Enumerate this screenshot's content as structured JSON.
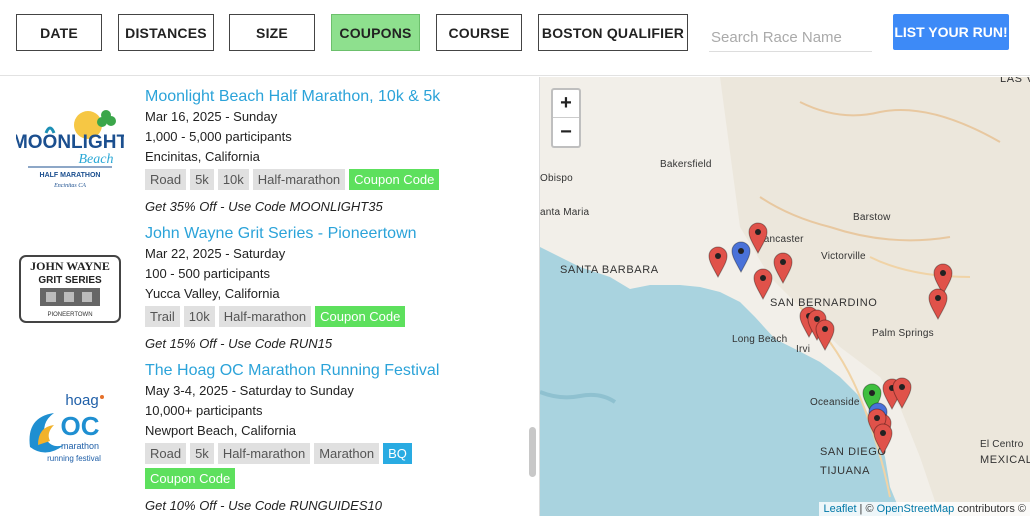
{
  "filters": [
    {
      "label": "DATE",
      "active": false
    },
    {
      "label": "DISTANCES",
      "active": false
    },
    {
      "label": "SIZE",
      "active": false
    },
    {
      "label": "COUPONS",
      "active": true
    },
    {
      "label": "COURSE",
      "active": false
    },
    {
      "label": "BOSTON QUALIFIER",
      "active": false
    }
  ],
  "search": {
    "placeholder": "Search Race Name"
  },
  "list_button": "LIST YOUR RUN!",
  "races": [
    {
      "title": "Moonlight Beach Half Marathon, 10k & 5k",
      "date": "Mar 16, 2025 - Sunday",
      "participants": "1,000 - 5,000 participants",
      "location": "Encinitas, California",
      "tags": [
        "Road",
        "5k",
        "10k",
        "Half-marathon"
      ],
      "coupon_tag": "Coupon Code",
      "coupon": "Get 35% Off - Use Code MOONLIGHT35",
      "logo": {
        "line1": "MOONLIGHT",
        "line2": "Beach",
        "line3": "HALF MARATHON",
        "line4": "Encinitas CA"
      }
    },
    {
      "title": "John Wayne Grit Series - Pioneertown",
      "date": "Mar 22, 2025 - Saturday",
      "participants": "100 - 500 participants",
      "location": "Yucca Valley, California",
      "tags": [
        "Trail",
        "10k",
        "Half-marathon"
      ],
      "coupon_tag": "Coupon Code",
      "coupon": "Get 15% Off - Use Code RUN15",
      "logo": {
        "line1": "JOHN WAYNE",
        "line2": "GRIT SERIES",
        "line3": "PIONEERTOWN"
      }
    },
    {
      "title": "The Hoag OC Marathon Running Festival",
      "date": "May 3-4, 2025 - Saturday to Sunday",
      "participants": "10,000+ participants",
      "location": "Newport Beach, California",
      "tags": [
        "Road",
        "5k",
        "Half-marathon",
        "Marathon"
      ],
      "bq_tag": "BQ",
      "coupon_tag": "Coupon Code",
      "coupon": "Get 10% Off - Use Code RUNGUIDES10",
      "logo": {
        "line1": "hoag",
        "line2": "OC",
        "line3": "marathon",
        "line4": "running festival"
      }
    }
  ],
  "map": {
    "zoom_in": "+",
    "zoom_out": "−",
    "labels": {
      "las_vegas": "LAS V",
      "bakersfield": "Bakersfield",
      "obispo": "Obispo",
      "santa_maria": "anta Maria",
      "barstow": "Barstow",
      "lancaster": "Lancaster",
      "victorville": "Victorville",
      "santa_barbara": "SANTA BARBARA",
      "san_bernardino": "SAN BERNARDINO",
      "long_beach": "Long Beach",
      "irvine": "Irvi",
      "palm_springs": "Palm Springs",
      "oceanside": "Oceanside",
      "el_centro": "El Centro",
      "mexicali": "MEXICAL",
      "san_diego": "SAN DIEGO",
      "tijuana": "TIJUANA"
    },
    "attribution": {
      "leaflet": "Leaflet",
      "sep": " | © ",
      "osm": "OpenStreetMap",
      "rest": " contributors ©"
    },
    "colors": {
      "red": "#e0524a",
      "blue": "#4a72d9",
      "green": "#3fbf3f",
      "water": "#a9d3df",
      "land": "#f2efe9"
    }
  }
}
